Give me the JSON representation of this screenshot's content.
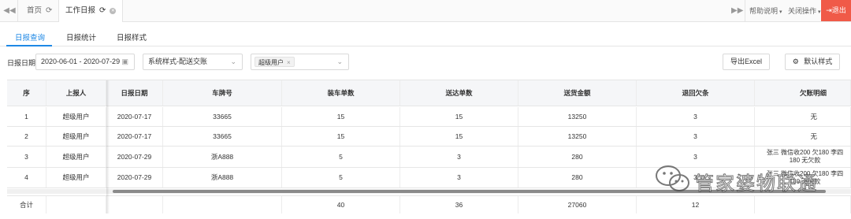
{
  "topbar": {
    "home_tab": "首页",
    "active_tab": "工作日报",
    "help_menu": "帮助说明",
    "close_menu": "关闭操作",
    "logout": "退出"
  },
  "subtabs": [
    "日报查询",
    "日报统计",
    "日报样式"
  ],
  "filters": {
    "date_label": "日报日期",
    "date_range": "2020-06-01 - 2020-07-29",
    "style_select": "系统样式-配送交账",
    "user_tag": "超级用户",
    "export_button": "导出Excel",
    "default_style_button": "默认样式"
  },
  "table": {
    "columns": [
      "序",
      "上报人",
      "日报日期",
      "车牌号",
      "装车单数",
      "送达单数",
      "送货金额",
      "退回欠条",
      "欠账明细"
    ],
    "rows": [
      [
        "1",
        "超级用户",
        "2020-07-17",
        "33665",
        "15",
        "15",
        "13250",
        "3",
        "无"
      ],
      [
        "2",
        "超级用户",
        "2020-07-17",
        "33665",
        "15",
        "15",
        "13250",
        "3",
        "无"
      ],
      [
        "3",
        "超级用户",
        "2020-07-29",
        "浙A888",
        "5",
        "3",
        "280",
        "3",
        "张三 微信收200 欠180 李四 180 无欠款"
      ],
      [
        "4",
        "超级用户",
        "2020-07-29",
        "浙A888",
        "5",
        "3",
        "280",
        "3",
        "张三 微信收200 欠180 李四 180 无欠款"
      ]
    ],
    "summary": {
      "label": "合计",
      "values": [
        "",
        "",
        "",
        "40",
        "36",
        "27060",
        "12",
        ""
      ]
    }
  },
  "watermark": "管家婆物联通",
  "colors": {
    "accent": "#1e88e5",
    "logout": "#f05a48"
  }
}
